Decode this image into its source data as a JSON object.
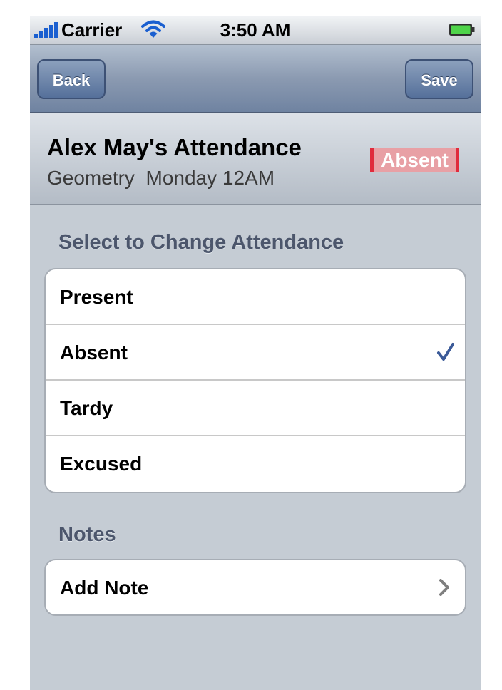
{
  "status_bar": {
    "carrier": "Carrier",
    "time": "3:50 AM"
  },
  "nav_bar": {
    "back_label": "Back",
    "save_label": "Save"
  },
  "summary": {
    "title": "Alex May's Attendance",
    "course": "Geometry",
    "session": "Monday 12AM",
    "status": "Absent"
  },
  "attendance": {
    "section_label": "Select to Change Attendance",
    "options": [
      {
        "label": "Present",
        "selected": false
      },
      {
        "label": "Absent",
        "selected": true
      },
      {
        "label": "Tardy",
        "selected": false
      },
      {
        "label": "Excused",
        "selected": false
      }
    ]
  },
  "notes": {
    "section_label": "Notes",
    "add_note_label": "Add Note"
  },
  "colors": {
    "accent_check": "#3b5a98",
    "badge_red": "#e02b3c",
    "nav_blue": "#6f83a1",
    "group_bg": "#c5ccd4"
  },
  "icons": {
    "signal": "signal-bars-icon",
    "wifi": "wifi-icon",
    "battery": "battery-icon",
    "check": "checkmark-icon",
    "disclosure": "chevron-right-icon"
  }
}
